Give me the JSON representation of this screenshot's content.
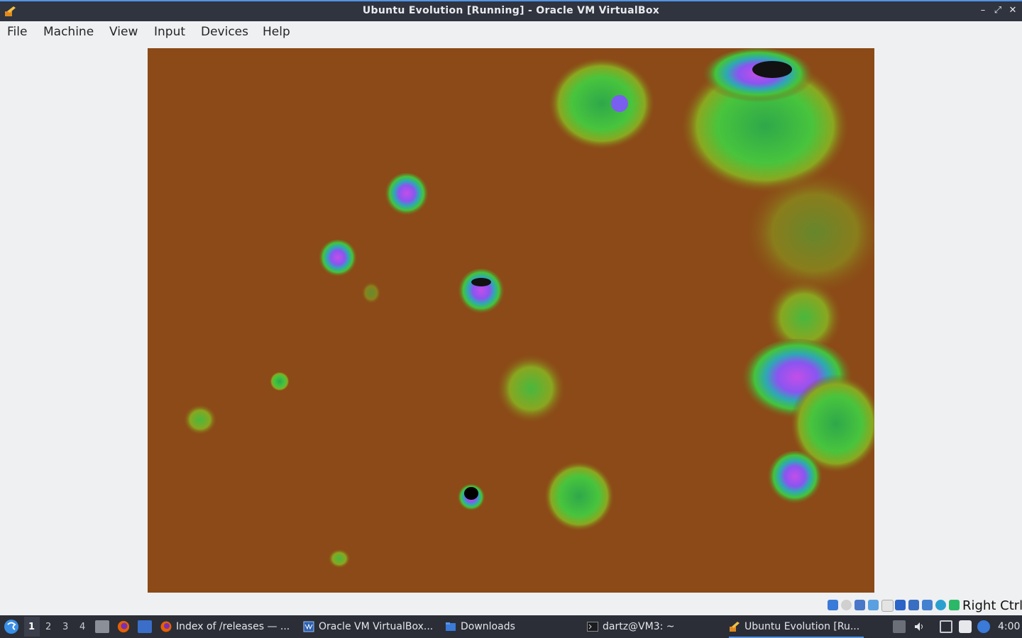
{
  "window": {
    "title": "Ubuntu Evolution [Running] - Oracle VM VirtualBox",
    "controls": {
      "minimize": "–",
      "restore": "⤢",
      "close": "✕"
    }
  },
  "menu": {
    "file": "File",
    "machine": "Machine",
    "view": "View",
    "input": "Input",
    "devices": "Devices",
    "help": "Help"
  },
  "vm": {
    "background": "#8b4a17"
  },
  "statusbar": {
    "host_key": "Right Ctrl",
    "icons": [
      "hard-disk-icon",
      "optical-drive-icon",
      "usb-icon",
      "shared-folders-icon",
      "display-icon",
      "video-capture-icon",
      "network-icon",
      "mouse-integration-icon",
      "cpu-icon",
      "audio-icon",
      "keyboard-capture-icon"
    ]
  },
  "taskbar": {
    "workspaces": [
      "1",
      "2",
      "3",
      "4"
    ],
    "active_workspace": "1",
    "tasks": [
      {
        "label": "Index of /releases — ...",
        "icon": "firefox-icon"
      },
      {
        "label": "Oracle VM VirtualBox...",
        "icon": "virtualbox-manager-icon"
      },
      {
        "label": "Downloads",
        "icon": "folder-icon"
      },
      {
        "label": "dartz@VM3: ~",
        "icon": "terminal-icon"
      },
      {
        "label": "Ubuntu Evolution [Ru...",
        "icon": "virtualbox-vm-icon",
        "active": true
      }
    ],
    "clock": "4:00"
  },
  "colors": {
    "accent": "#5294e2",
    "titlebar": "#2f343f",
    "taskbar": "#2b2e37"
  }
}
